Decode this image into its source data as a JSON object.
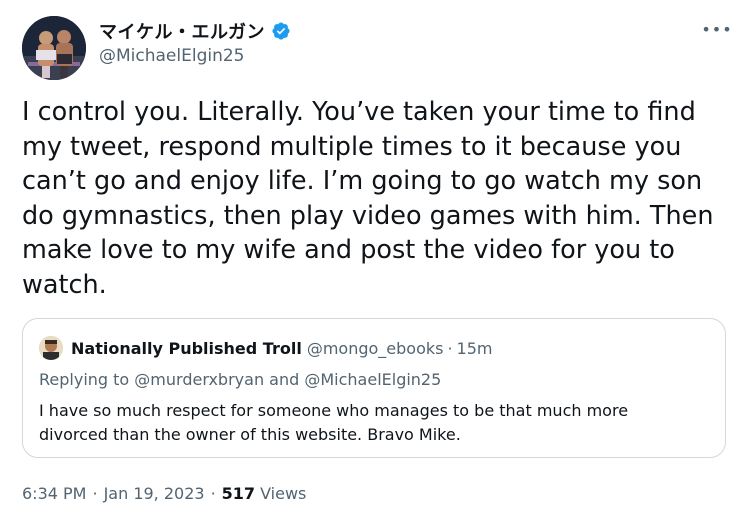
{
  "tweet": {
    "display_name": "マイケル・エルガン",
    "handle": "@MichaelElgin25",
    "verified_icon": "verified-badge",
    "more_label": "•••",
    "text": "I control you. Literally. You’ve taken your time to find my tweet, respond multiple times to it because you can’t go and enjoy life. I’m going to go watch my son do gymnastics, then play video games with him. Then make love to my wife and post the video for you to watch.",
    "time": "6:34 PM",
    "date": "Jan 19, 2023",
    "separator": "·",
    "views_count": "517",
    "views_label": "Views"
  },
  "quote": {
    "display_name": "Nationally Published Troll",
    "handle": "@mongo_ebooks",
    "separator": "·",
    "time": "15m",
    "replying_to": "Replying to @murderxbryan and @MichaelElgin25",
    "text": "I have so much respect for someone who manages to be that much more divorced than the owner of this website. Bravo Mike."
  },
  "colors": {
    "text_primary": "#0f1419",
    "text_secondary": "#536471",
    "verified_blue": "#1d9bf0",
    "border": "#cfd9de"
  }
}
